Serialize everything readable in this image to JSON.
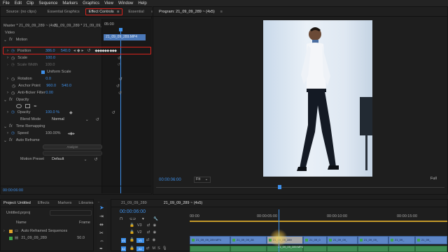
{
  "menu": [
    "File",
    "Edit",
    "Clip",
    "Sequence",
    "Markers",
    "Graphics",
    "View",
    "Window",
    "Help"
  ],
  "source_panel": {
    "tabs": [
      "Source: (no clips)",
      "Essential Graphics",
      "Effect Controls",
      "Essential"
    ],
    "effect_controls_icon": "≡",
    "overflow": "»",
    "master_label": "Master * 21_09_09_289 ~ (4x5)",
    "sequence_label": "21_09_09_289 * 21_09_09_28...",
    "mini_time": "05:00",
    "mini_clip": "21_09_09_289.MP4",
    "section_video": "Video",
    "motion": {
      "title": "Motion",
      "position_label": "Position",
      "position_x": "386.0",
      "position_y": "540.0",
      "scale_label": "Scale",
      "scale_value": "100.0",
      "scale_width_label": "Scale Width",
      "scale_width_value": "100.0",
      "uniform_scale": "Uniform Scale",
      "rotation_label": "Rotation",
      "rotation_value": "0.0",
      "anchor_label": "Anchor Point",
      "anchor_x": "960.0",
      "anchor_y": "540.0",
      "flicker_label": "Anti-flicker Filter",
      "flicker_value": "0.00"
    },
    "opacity": {
      "title": "Opacity",
      "opacity_label": "Opacity",
      "opacity_value": "100.0 %",
      "blend_label": "Blend Mode",
      "blend_value": "Normal"
    },
    "time_remap": {
      "title": "Time Remapping",
      "speed_label": "Speed",
      "speed_value": "100.00%"
    },
    "auto_reframe": {
      "title": "Auto Reframe",
      "analyze_btn": "Analyze",
      "preset_label": "Motion Preset",
      "preset_value": "Default"
    },
    "bottom_time": "00:00:06:00"
  },
  "program": {
    "title": "Program: 21_09_09_289 ~ (4x5)",
    "menu_icon": "≡",
    "timecode": "00:00:06:00",
    "fit": "Fit",
    "quality": "Full"
  },
  "project": {
    "tabs": [
      "Project: Untitled",
      "Effects",
      "Markers",
      "Libraries"
    ],
    "overflow": "»",
    "filename": "Untitled.prproj",
    "col_name": "Name",
    "col_frame": "Frame",
    "items": [
      {
        "name": "Auto Reframed Sequences",
        "frame": ""
      },
      {
        "name": "21_09_09_289",
        "frame": "50.0"
      }
    ]
  },
  "timeline": {
    "tab1": "21_09_09_289",
    "tab2": "21_09_09_289 ~ (4x5)",
    "timecode": "00:00:06:00",
    "ruler": [
      "00:00",
      "00:00:05:00",
      "00:00:10:00",
      "00:00:15:00"
    ],
    "tracks": [
      "V3",
      "V2",
      "V1",
      "A1"
    ],
    "clips": [
      "21_09_09_289.MP4",
      "21_09_09_28",
      "21_09_09_289",
      "21_09_0",
      "21_09_09_",
      "21_09_09_",
      "21_09_",
      "21_09_"
    ],
    "overlay_label": "21_09_09_289.MP4"
  },
  "colors": {
    "accent_blue": "#3e8fe8",
    "highlight_red": "#d9231d",
    "clip_blue": "#5d86c7",
    "audio_green": "#3f8c53"
  }
}
